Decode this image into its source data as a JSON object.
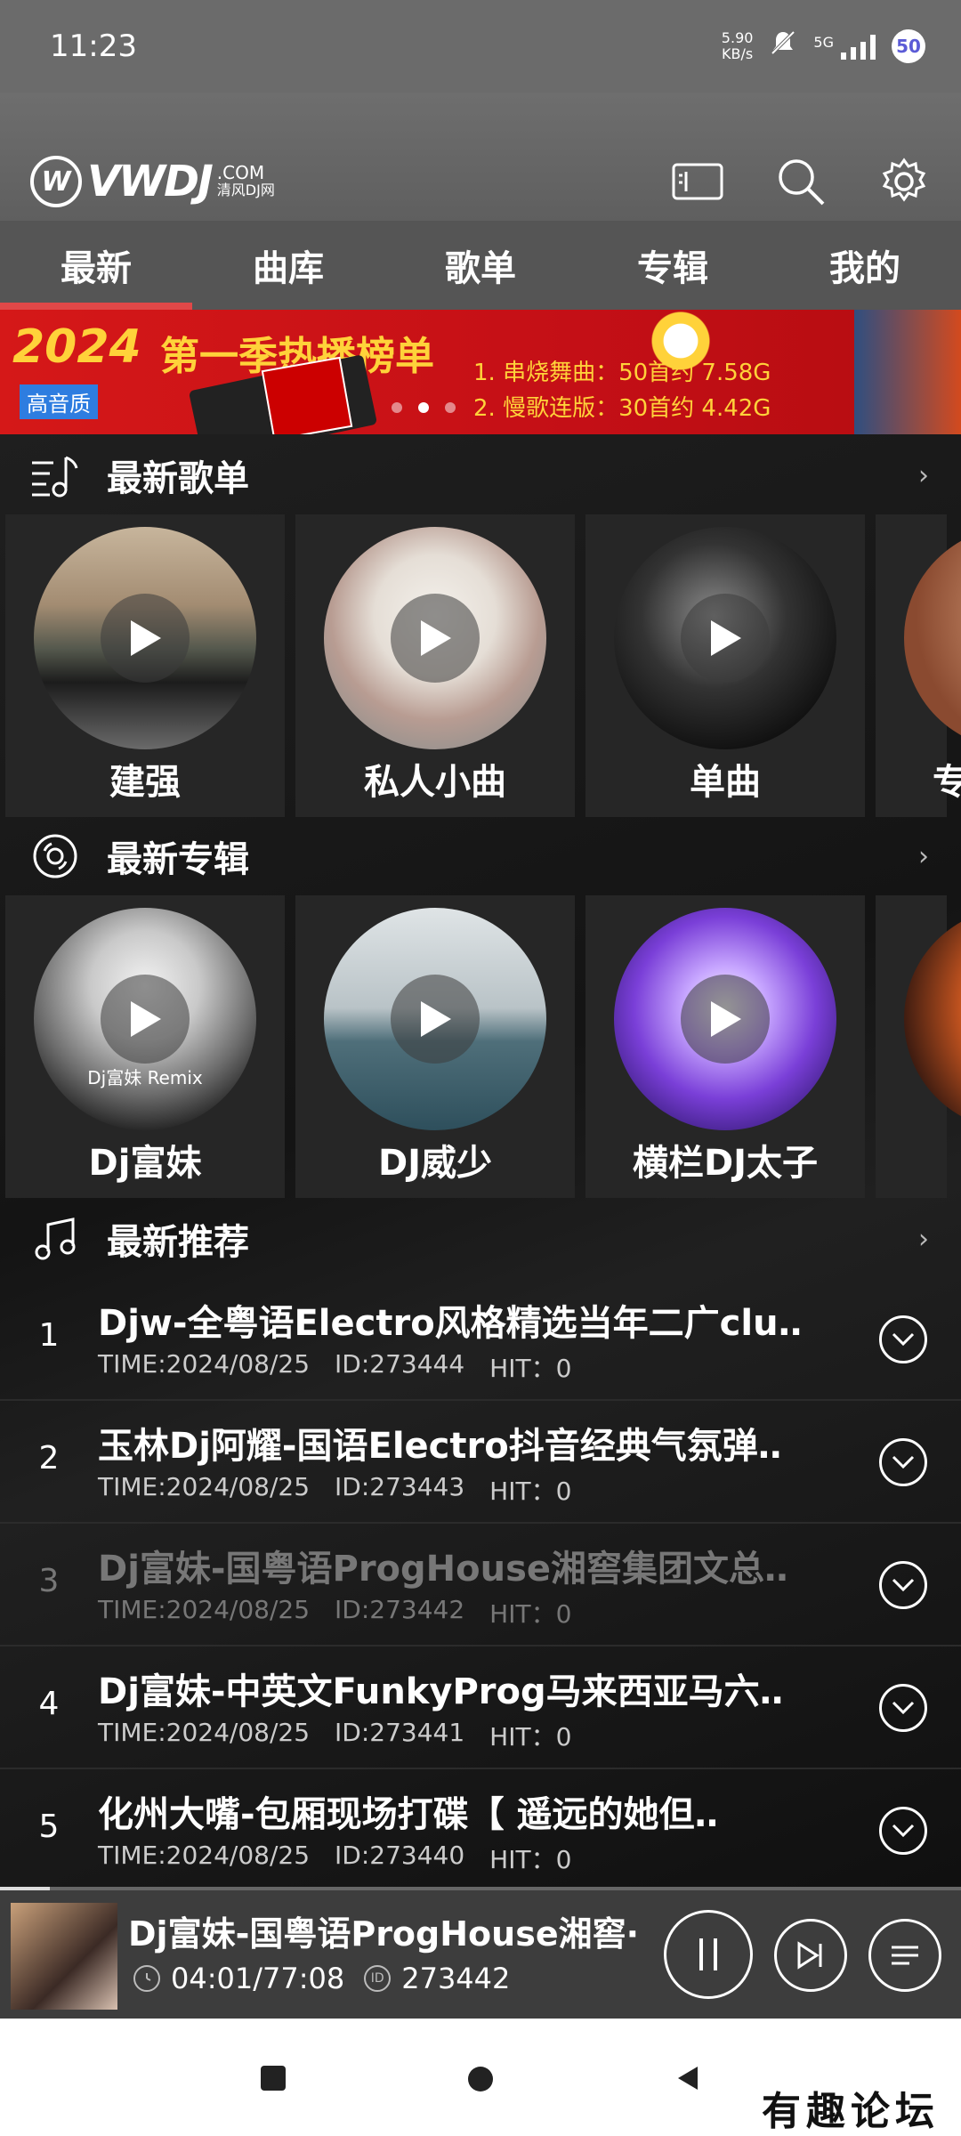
{
  "status_bar": {
    "time": "11:23",
    "net_speed_value": "5.90",
    "net_speed_unit": "KB/s",
    "network": "5G",
    "battery": "50"
  },
  "header": {
    "logo_text": "VWDJ",
    "logo_domain": ".COM",
    "logo_sub": "清风DJ网"
  },
  "tabs": [
    {
      "label": "最新",
      "active": true
    },
    {
      "label": "曲库"
    },
    {
      "label": "歌单"
    },
    {
      "label": "专辑"
    },
    {
      "label": "我的"
    }
  ],
  "banner": {
    "year": "2024",
    "title": "第一季热播榜单",
    "badge": "高音质",
    "line1": "1. 串烧舞曲：50首约 7.58G",
    "line2": "2. 慢歌连版：30首约 4.42G"
  },
  "sections": {
    "playlists": {
      "title": "最新歌单",
      "more": "›"
    },
    "albums": {
      "title": "最新专辑",
      "more": "›"
    },
    "recommend": {
      "title": "最新推荐",
      "more": "›"
    }
  },
  "playlists": [
    {
      "label": "建强"
    },
    {
      "label": "私人小曲"
    },
    {
      "label": "单曲"
    },
    {
      "label": "专"
    }
  ],
  "albums": [
    {
      "label": "Dj富妹",
      "cover_note": "Dj富妹 Remix"
    },
    {
      "label": "DJ威少"
    },
    {
      "label": "横栏DJ太子"
    },
    {
      "label": ""
    }
  ],
  "recommend": [
    {
      "num": "1",
      "title": "Djw-全粤语Electro风格精选当年二广clu‥",
      "time": "TIME:2024/08/25",
      "id": "ID:273444",
      "hit": "HIT：0"
    },
    {
      "num": "2",
      "title": "玉林Dj阿耀-国语Electro抖音经典气氛弹‥",
      "time": "TIME:2024/08/25",
      "id": "ID:273443",
      "hit": "HIT：0"
    },
    {
      "num": "3",
      "title": "Dj富妹-国粤语ProgHouse湘窖集团文总‥",
      "time": "TIME:2024/08/25",
      "id": "ID:273442",
      "hit": "HIT：0"
    },
    {
      "num": "4",
      "title": "Dj富妹-中英文FunkyProg马来西亚马六‥",
      "time": "TIME:2024/08/25",
      "id": "ID:273441",
      "hit": "HIT：0"
    },
    {
      "num": "5",
      "title": "化州大嘴-包厢现场打碟【 遥远的她但‥",
      "time": "TIME:2024/08/25",
      "id": "ID:273440",
      "hit": "HIT：0"
    }
  ],
  "player": {
    "title": "Dj富妹-国粤语ProgHouse湘窖·",
    "time": "04:01/77:08",
    "id_badge": "ID",
    "id": "273442",
    "progress": 0.052
  },
  "watermark": "有趣论坛"
}
